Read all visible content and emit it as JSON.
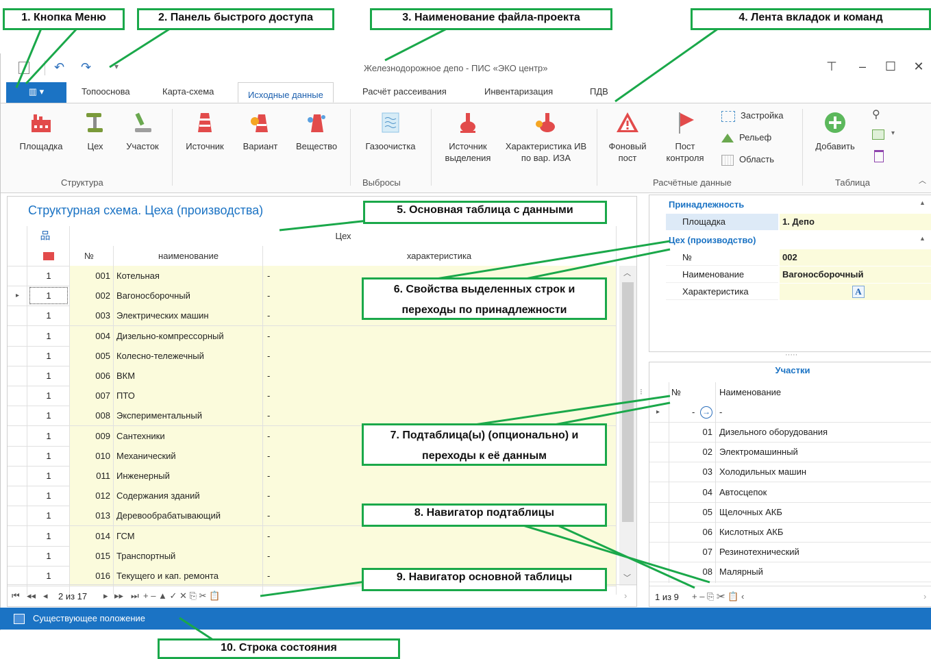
{
  "window": {
    "title": "Железнодорожное депо - ПИС «ЭКО центр»",
    "qat": {
      "undo": "↶",
      "redo": "↷",
      "customize": "▾"
    },
    "controls": {
      "pin": "⊤",
      "minimize": "–",
      "maximize": "☐",
      "close": "✕"
    }
  },
  "tabs": {
    "menu": "▥ ▾",
    "items": [
      "Топооснова",
      "Карта-схема",
      "Исходные данные",
      "Расчёт рассеивания",
      "Инвентаризация",
      "ПДВ"
    ],
    "active": "Исходные данные"
  },
  "ribbon": {
    "structure": {
      "group": "Структура",
      "buttons": [
        "Площадка",
        "Цех",
        "Участок"
      ]
    },
    "emissions": {
      "group": "Выбросы",
      "buttons": [
        "Источник",
        "Вариант",
        "Вещество",
        "Газоочистка",
        "Источник выделения",
        "Характеристика ИВ по вар. ИЗА"
      ]
    },
    "calc": {
      "group": "Расчётные данные",
      "buttons": [
        "Фоновый пост",
        "Пост контроля"
      ],
      "small": [
        "Застройка",
        "Рельеф",
        "Область"
      ]
    },
    "table": {
      "group": "Таблица",
      "buttons": [
        "Добавить"
      ]
    }
  },
  "main": {
    "title": "Структурная схема. Цеха (производства)",
    "group_header": "Цех",
    "col_no": "№",
    "col_name": "наименование",
    "col_char": "характеристика",
    "rows": [
      {
        "p": "1",
        "n": "001",
        "name": "Котельная",
        "ch": "-"
      },
      {
        "p": "1",
        "n": "002",
        "name": "Вагоносборочный",
        "ch": "-"
      },
      {
        "p": "1",
        "n": "003",
        "name": "Электрических машин",
        "ch": "-"
      },
      {
        "p": "1",
        "n": "004",
        "name": "Дизельно-компрессорный",
        "ch": "-"
      },
      {
        "p": "1",
        "n": "005",
        "name": "Колесно-тележечный",
        "ch": "-"
      },
      {
        "p": "1",
        "n": "006",
        "name": "ВКМ",
        "ch": "-"
      },
      {
        "p": "1",
        "n": "007",
        "name": "ПТО",
        "ch": "-"
      },
      {
        "p": "1",
        "n": "008",
        "name": "Экспериментальный",
        "ch": "-"
      },
      {
        "p": "1",
        "n": "009",
        "name": "Сантехники",
        "ch": "-"
      },
      {
        "p": "1",
        "n": "010",
        "name": "Механический",
        "ch": "-"
      },
      {
        "p": "1",
        "n": "011",
        "name": "Инженерный",
        "ch": "-"
      },
      {
        "p": "1",
        "n": "012",
        "name": "Содержания зданий",
        "ch": "-"
      },
      {
        "p": "1",
        "n": "013",
        "name": "Деревообрабатывающий",
        "ch": "-"
      },
      {
        "p": "1",
        "n": "014",
        "name": "ГСМ",
        "ch": "-"
      },
      {
        "p": "1",
        "n": "015",
        "name": "Транспортный",
        "ch": "-"
      },
      {
        "p": "1",
        "n": "016",
        "name": "Текущего и кап. ремонта",
        "ch": "-"
      }
    ],
    "nav": {
      "first": "⏮",
      "prev_page": "◂◂",
      "prev": "◂",
      "position": "2 из 17",
      "next": "▸",
      "next_page": "▸▸",
      "last": "⏭",
      "tools": "+ – ▲ ✓ ✕ ⎘ ✂ 📋"
    }
  },
  "props": {
    "section1": "Принадлежность",
    "site_label": "Площадка",
    "site_value": "1. Депо",
    "section2": "Цех (производство)",
    "no_label": "№",
    "no_value": "002",
    "name_label": "Наименование",
    "name_value": "Вагоносборочный",
    "char_label": "Характеристика",
    "char_value": "A"
  },
  "sub": {
    "splitter": "·····",
    "title": "Участки",
    "col_no": "№",
    "col_name": "Наименование",
    "first_row": {
      "n": "-",
      "name": "-"
    },
    "rows": [
      {
        "n": "01",
        "name": "Дизельного оборудования"
      },
      {
        "n": "02",
        "name": "Электромашинный"
      },
      {
        "n": "03",
        "name": "Холодильных машин"
      },
      {
        "n": "04",
        "name": "Автосцепок"
      },
      {
        "n": "05",
        "name": "Щелочных АКБ"
      },
      {
        "n": "06",
        "name": "Кислотных АКБ"
      },
      {
        "n": "07",
        "name": "Резинотехнический"
      },
      {
        "n": "08",
        "name": "Малярный"
      }
    ],
    "nav": {
      "position": "1 из 9",
      "tools": "+ – ⎘ ✂ 📋 ‹"
    }
  },
  "status": {
    "text": "Существующее положение"
  },
  "callouts": {
    "c1": "1. Кнопка Меню",
    "c2": "2. Панель быстрого доступа",
    "c3": "3. Наименование файла-проекта",
    "c4": "4. Лента вкладок и команд",
    "c5": "5. Основная таблица с данными",
    "c6a": "6. Свойства выделенных строк и",
    "c6b": "переходы по принадлежности",
    "c7a": "7. Подтаблица(ы) (опционально) и",
    "c7b": "переходы к её данным",
    "c8": "8. Навигатор подтаблицы",
    "c9": "9. Навигатор основной таблицы",
    "c10": "10. Строка состояния"
  },
  "colors": {
    "accent": "#1b73c4",
    "callout_border": "#1aa84a",
    "row_bg": "#fbfbdc",
    "icon_red": "#e24b4b"
  }
}
